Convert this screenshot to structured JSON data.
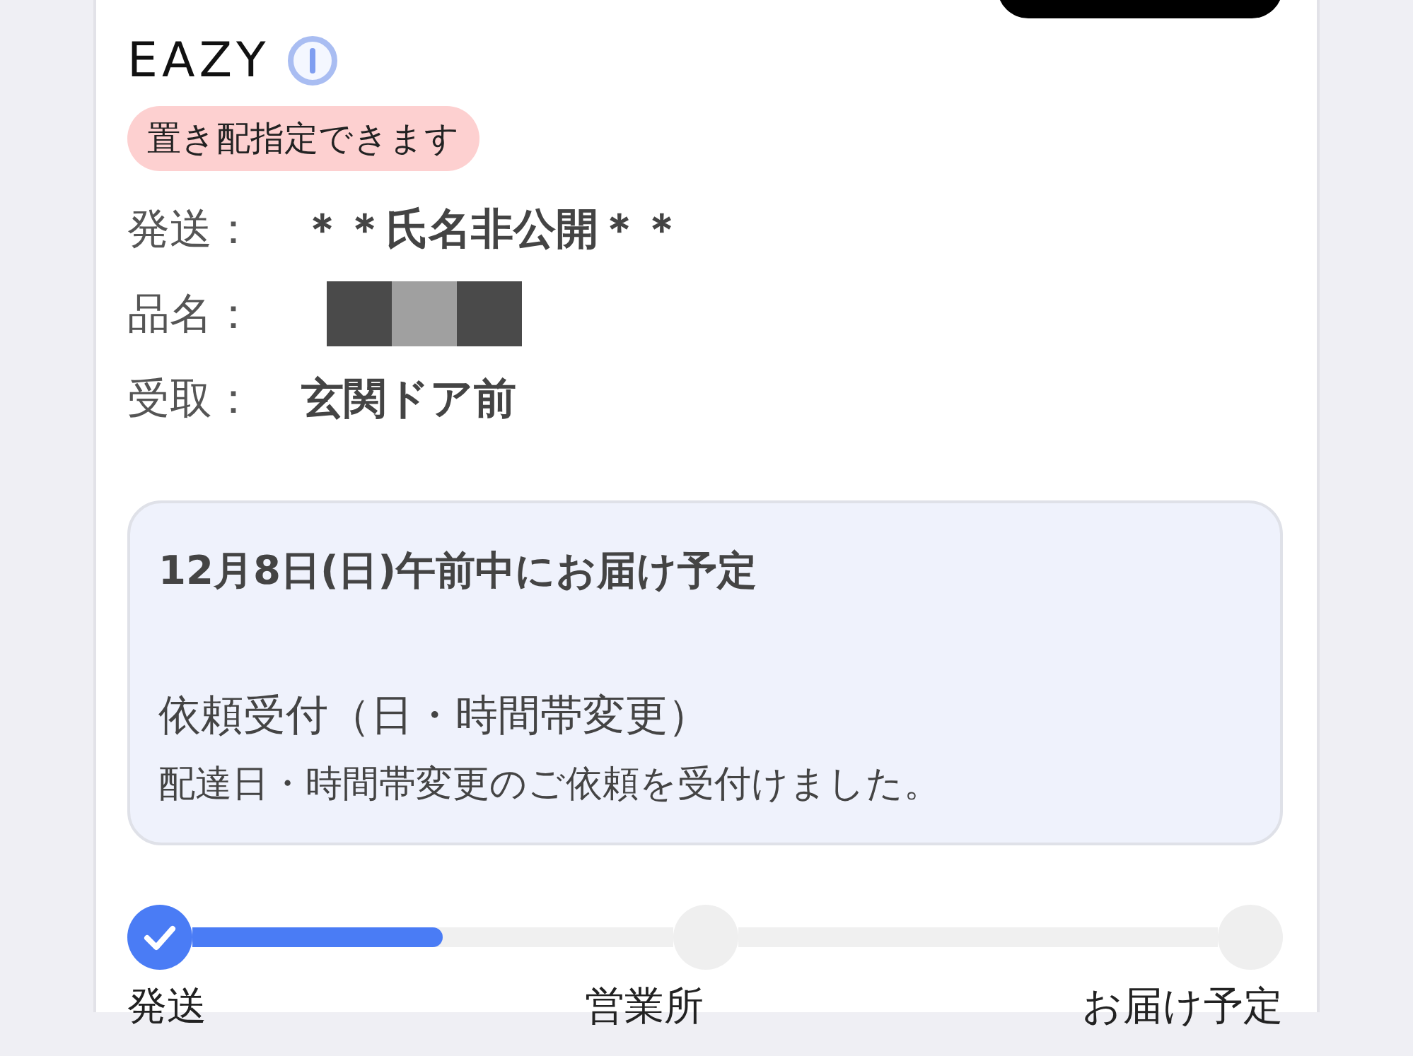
{
  "brand": {
    "logo": "EAZY"
  },
  "badge": "置き配指定できます",
  "details": [
    {
      "label": "発送：",
      "value": "＊＊氏名非公開＊＊",
      "kind": "text"
    },
    {
      "label": "品名：",
      "kind": "redacted"
    },
    {
      "label": "受取：",
      "value": "玄関ドア前",
      "kind": "text"
    }
  ],
  "status_box": {
    "schedule": "12月8日(日)午前中にお届け予定",
    "title": "依頼受付（日・時間帯変更）",
    "message": "配達日・時間帯変更のご依頼を受付けました。"
  },
  "progress": {
    "steps": [
      {
        "label": "発送",
        "done": true
      },
      {
        "label": "営業所",
        "done": false
      },
      {
        "label": "お届け予定",
        "done": false
      }
    ],
    "segments": [
      {
        "level": 0.52
      }
    ]
  }
}
